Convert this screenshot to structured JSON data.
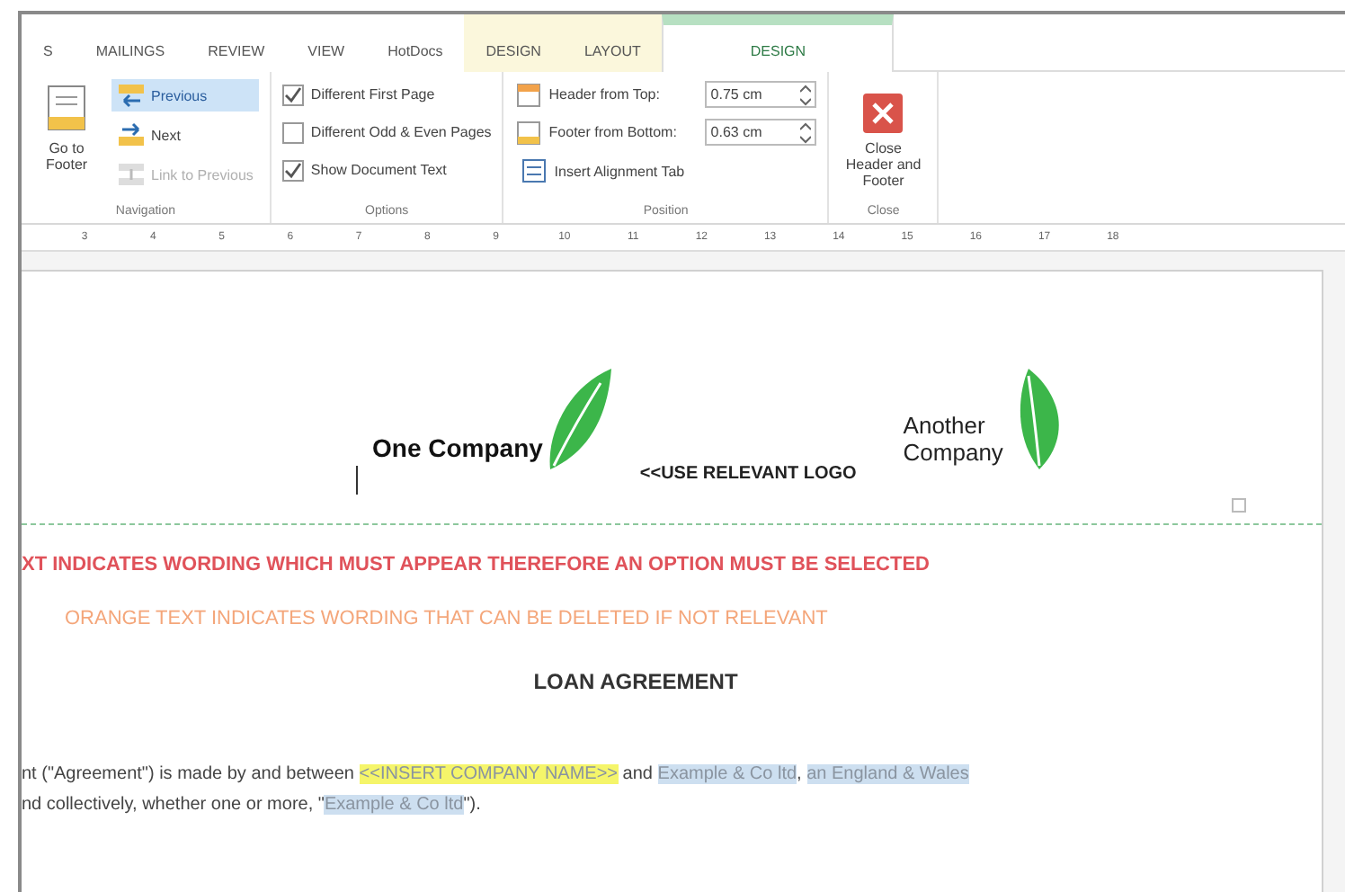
{
  "ribbon": {
    "tabs": [
      {
        "label": "S",
        "kind": "plain",
        "selected": false
      },
      {
        "label": "MAILINGS",
        "kind": "plain",
        "selected": false
      },
      {
        "label": "REVIEW",
        "kind": "plain",
        "selected": false
      },
      {
        "label": "VIEW",
        "kind": "plain",
        "selected": false
      },
      {
        "label": "HotDocs",
        "kind": "plain",
        "selected": false
      },
      {
        "label": "DESIGN",
        "kind": "table",
        "selected": false
      },
      {
        "label": "LAYOUT",
        "kind": "table",
        "selected": false
      },
      {
        "label": "DESIGN",
        "kind": "headerfooter",
        "selected": true
      }
    ],
    "groups": [
      {
        "label": "Navigation",
        "items": [
          {
            "kind": "large",
            "label": "Go to Footer"
          },
          {
            "kind": "small",
            "label": "Previous",
            "selected": true,
            "disabled": false
          },
          {
            "kind": "small",
            "label": "Next",
            "selected": false,
            "disabled": false
          },
          {
            "kind": "small",
            "label": "Link to Previous",
            "selected": false,
            "disabled": true
          }
        ]
      },
      {
        "label": "Options",
        "items": [
          {
            "kind": "checkbox",
            "label": "Different First Page",
            "checked": true
          },
          {
            "kind": "checkbox",
            "label": "Different Odd & Even Pages",
            "checked": false
          },
          {
            "kind": "checkbox",
            "label": "Show Document Text",
            "checked": true
          }
        ]
      },
      {
        "label": "Position",
        "items": [
          {
            "kind": "spin",
            "label": "Header from Top:",
            "value": "0.75 cm"
          },
          {
            "kind": "spin",
            "label": "Footer from Bottom:",
            "value": "0.63 cm"
          },
          {
            "kind": "small",
            "label": "Insert Alignment Tab",
            "selected": false,
            "disabled": false
          }
        ]
      },
      {
        "label": "Close",
        "items": [
          {
            "kind": "large",
            "label": "Close Header and Footer"
          }
        ]
      }
    ]
  },
  "ruler": [
    "3",
    "4",
    "5",
    "6",
    "7",
    "8",
    "9",
    "10",
    "11",
    "12",
    "13",
    "14",
    "15",
    "16",
    "17",
    "18"
  ],
  "header": {
    "left_logo": "One Company",
    "placeholder_note": "<<USE RELEVANT LOGO",
    "right_logo": "Another Company"
  },
  "body": [
    {
      "kind": "red_note",
      "text": "XT INDICATES WORDING WHICH MUST APPEAR THEREFORE AN OPTION MUST BE SELECTED"
    },
    {
      "kind": "orange_note",
      "text": "ORANGE TEXT INDICATES WORDING THAT CAN BE DELETED IF NOT RELEVANT"
    },
    {
      "kind": "title",
      "text": "LOAN AGREEMENT"
    },
    {
      "kind": "paragraph",
      "lines": [
        [
          {
            "text": "nt (\"Agreement\") is made by and between "
          },
          {
            "text": "<<INSERT COMPANY NAME>>",
            "color": "#f5f56a"
          },
          {
            "text": " and "
          },
          {
            "text": "Example & Co ltd",
            "color": "#cddff0"
          },
          {
            "text": ", "
          },
          {
            "text": "an England & Wales",
            "color": "#cddff0"
          }
        ],
        [
          {
            "text": "nd collectively, whether one or more, \""
          },
          {
            "text": "Example & Co ltd",
            "color": "#cddff0"
          },
          {
            "text": "\")."
          }
        ]
      ]
    }
  ]
}
